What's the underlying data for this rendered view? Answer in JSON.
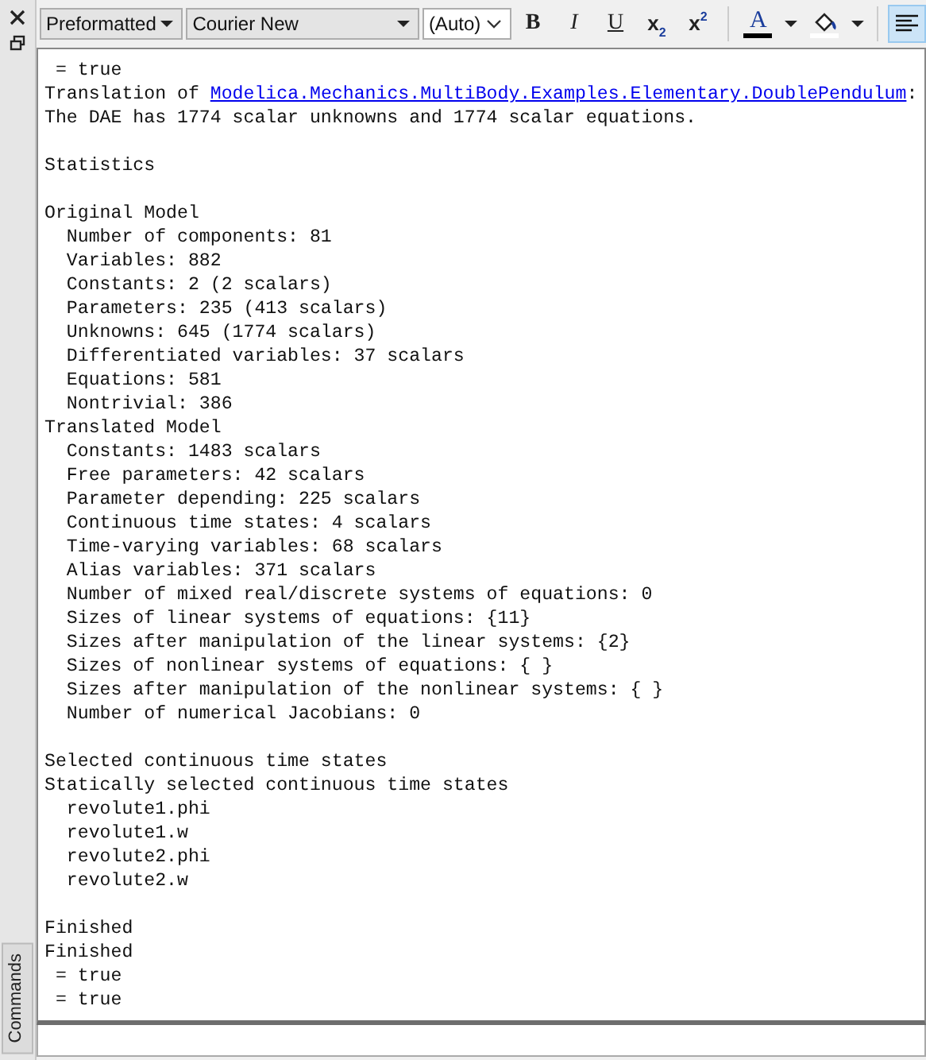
{
  "side_panel": {
    "title": "Commands"
  },
  "toolbar": {
    "style_select": "Preformatted",
    "font_select": "Courier New",
    "size_select": "(Auto)",
    "buttons": [
      {
        "kind": "bold",
        "label": "B",
        "selected": false
      },
      {
        "kind": "italic",
        "label": "I",
        "selected": false
      },
      {
        "kind": "underline",
        "label": "U",
        "selected": false
      },
      {
        "kind": "script",
        "label": "x$_{2}$",
        "selected": false
      },
      {
        "kind": "script",
        "label": "x$^{2}$",
        "selected": false
      },
      {
        "kind": "color",
        "label": "A",
        "color": "#000000",
        "selected": false
      },
      {
        "kind": "fill",
        "color": "#ffffff",
        "selected": false
      },
      {
        "kind": "align",
        "selected": true
      }
    ]
  },
  "log": [
    {
      "kind": "plain",
      "text": " = true"
    },
    {
      "kind": "link",
      "before": "Translation of ",
      "link": "Modelica.Mechanics.MultiBody.Examples.Elementary.DoublePendulum",
      "after": ":"
    },
    {
      "kind": "plain",
      "text": "The DAE has 1774 scalar unknowns and 1774 scalar equations."
    },
    {
      "kind": "blank"
    },
    {
      "kind": "plain",
      "text": "Statistics"
    },
    {
      "kind": "blank"
    },
    {
      "kind": "plain",
      "text": "Original Model"
    },
    {
      "kind": "plain",
      "text": "  Number of components: 81"
    },
    {
      "kind": "plain",
      "text": "  Variables: 882"
    },
    {
      "kind": "plain",
      "text": "  Constants: 2 (2 scalars)"
    },
    {
      "kind": "plain",
      "text": "  Parameters: 235 (413 scalars)"
    },
    {
      "kind": "plain",
      "text": "  Unknowns: 645 (1774 scalars)"
    },
    {
      "kind": "plain",
      "text": "  Differentiated variables: 37 scalars"
    },
    {
      "kind": "plain",
      "text": "  Equations: 581"
    },
    {
      "kind": "plain",
      "text": "  Nontrivial: 386"
    },
    {
      "kind": "plain",
      "text": "Translated Model"
    },
    {
      "kind": "plain",
      "text": "  Constants: 1483 scalars"
    },
    {
      "kind": "plain",
      "text": "  Free parameters: 42 scalars"
    },
    {
      "kind": "plain",
      "text": "  Parameter depending: 225 scalars"
    },
    {
      "kind": "plain",
      "text": "  Continuous time states: 4 scalars"
    },
    {
      "kind": "plain",
      "text": "  Time-varying variables: 68 scalars"
    },
    {
      "kind": "plain",
      "text": "  Alias variables: 371 scalars"
    },
    {
      "kind": "plain",
      "text": "  Number of mixed real/discrete systems of equations: 0"
    },
    {
      "kind": "plain",
      "text": "  Sizes of linear systems of equations: {11}"
    },
    {
      "kind": "plain",
      "text": "  Sizes after manipulation of the linear systems: {2}"
    },
    {
      "kind": "plain",
      "text": "  Sizes of nonlinear systems of equations: { }"
    },
    {
      "kind": "plain",
      "text": "  Sizes after manipulation of the nonlinear systems: { }"
    },
    {
      "kind": "plain",
      "text": "  Number of numerical Jacobians: 0"
    },
    {
      "kind": "blank"
    },
    {
      "kind": "plain",
      "text": "Selected continuous time states"
    },
    {
      "kind": "plain",
      "text": "Statically selected continuous time states"
    },
    {
      "kind": "plain",
      "text": "  revolute1.phi"
    },
    {
      "kind": "plain",
      "text": "  revolute1.w"
    },
    {
      "kind": "plain",
      "text": "  revolute2.phi"
    },
    {
      "kind": "plain",
      "text": "  revolute2.w"
    },
    {
      "kind": "blank"
    },
    {
      "kind": "plain",
      "text": "Finished"
    },
    {
      "kind": "plain",
      "text": "Finished"
    },
    {
      "kind": "plain",
      "text": " = true"
    },
    {
      "kind": "plain",
      "text": " = true"
    }
  ]
}
